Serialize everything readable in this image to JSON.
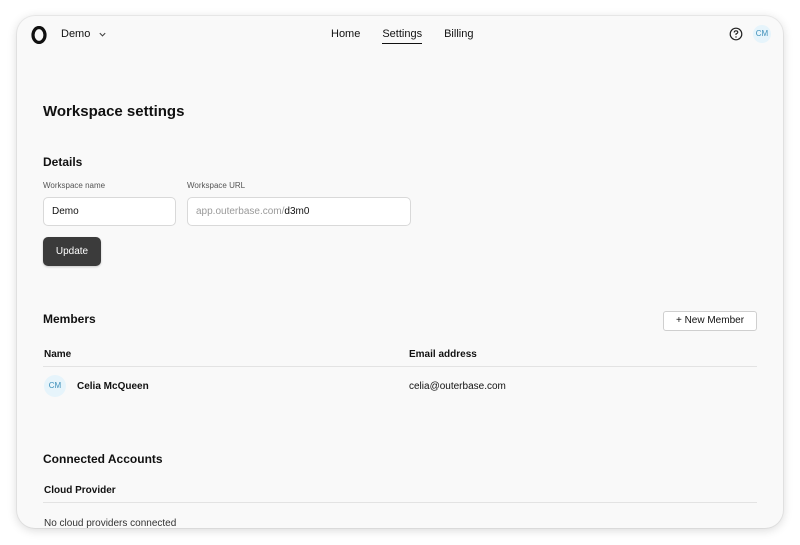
{
  "header": {
    "workspace_name": "Demo",
    "nav": [
      {
        "label": "Home",
        "active": false
      },
      {
        "label": "Settings",
        "active": true
      },
      {
        "label": "Billing",
        "active": false
      }
    ],
    "user_initials": "CM"
  },
  "page": {
    "title": "Workspace settings"
  },
  "details": {
    "title": "Details",
    "name_label": "Workspace name",
    "name_value": "Demo",
    "url_label": "Workspace URL",
    "url_prefix": "app.outerbase.com/",
    "url_value": "d3m0",
    "update_label": "Update"
  },
  "members": {
    "title": "Members",
    "new_member_label": "+ New Member",
    "columns": {
      "name": "Name",
      "email": "Email address"
    },
    "rows": [
      {
        "initials": "CM",
        "name": "Celia McQueen",
        "email": "celia@outerbase.com"
      }
    ]
  },
  "connected": {
    "title": "Connected Accounts",
    "column": "Cloud Provider",
    "empty_text": "No cloud providers connected"
  },
  "colors": {
    "window_bg": "#f9f9f9",
    "primary_button": "#3b3b3b",
    "avatar_bg": "#e6f4fb",
    "avatar_text": "#3a8db8"
  }
}
